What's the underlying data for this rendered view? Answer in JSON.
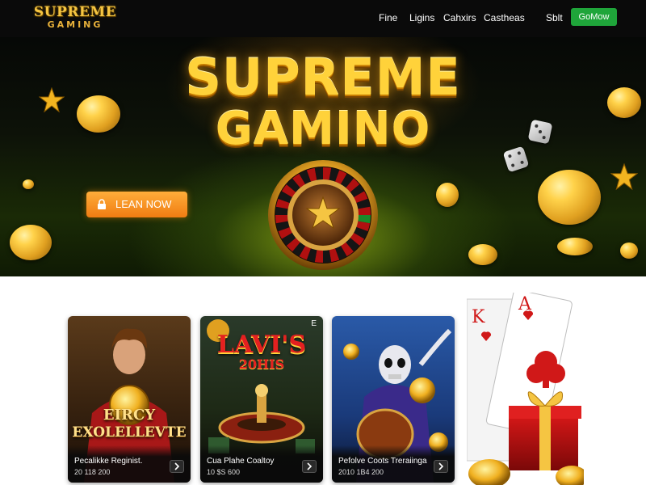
{
  "brand": {
    "logo_top": "SUPREME",
    "logo_bottom": "GAMING"
  },
  "nav": {
    "links": [
      "Fine",
      "Ligins",
      "Cahxirs",
      "Castheas",
      "Sblt"
    ],
    "cta": "GoMow"
  },
  "hero": {
    "title_line1": "SUPREME",
    "title_line2": "GAMINO",
    "cta": "LEAN NOW",
    "cta_icon": "lock-icon"
  },
  "cards": [
    {
      "art_text_line1": "EIRCY",
      "art_text_line2": "EXOLELLEVTE",
      "title": "Pecalikke Reginist.",
      "meta": "20 118 200"
    },
    {
      "art_text_line1": "LAVI'S",
      "art_text_line2": "20HIS",
      "corner_glyph": "E",
      "title": "Cua Plahe Coaltoy",
      "meta": "10 $S 600"
    },
    {
      "art_text_line1": "",
      "art_text_line2": "",
      "title": "Pefolve Coots Treraiinga",
      "meta": "2010 1B4 200"
    }
  ],
  "promo": {
    "card_k": "K",
    "card_a": "A"
  },
  "colors": {
    "nav_bg": "#0a0a0a",
    "accent_gold": "#ffd23a",
    "cta_green": "#1fa53a",
    "cta_orange": "#f07c12",
    "page_bg": "#ffffff"
  }
}
